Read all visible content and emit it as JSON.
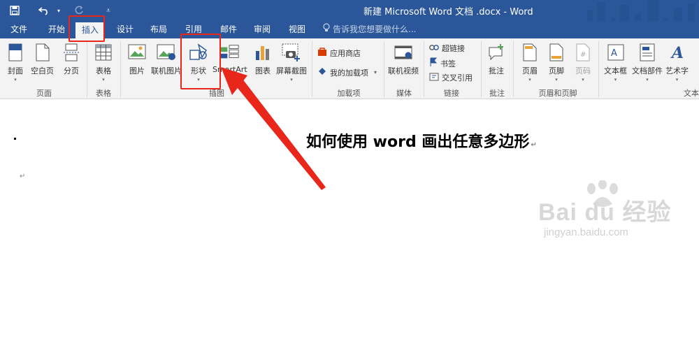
{
  "titlebar": {
    "title": "新建 Microsoft Word 文档 .docx - Word",
    "qat": {
      "save_icon": "save-icon",
      "undo_icon": "undo-icon",
      "redo_icon": "redo-icon",
      "customize_icon": "customize-icon"
    }
  },
  "tabs": [
    {
      "label": "文件",
      "active": false
    },
    {
      "label": "开始",
      "active": false
    },
    {
      "label": "插入",
      "active": true
    },
    {
      "label": "设计",
      "active": false
    },
    {
      "label": "布局",
      "active": false
    },
    {
      "label": "引用",
      "active": false
    },
    {
      "label": "邮件",
      "active": false
    },
    {
      "label": "审阅",
      "active": false
    },
    {
      "label": "视图",
      "active": false
    }
  ],
  "tell_me": {
    "placeholder": "告诉我您想要做什么..."
  },
  "ribbon": {
    "pages": {
      "cover": "封面",
      "blank": "空白页",
      "break": "分页",
      "group": "页面"
    },
    "tables": {
      "table": "表格",
      "group": "表格"
    },
    "illustrations": {
      "picture": "图片",
      "online_picture": "联机图片",
      "shapes": "形状",
      "smartart": "SmartArt",
      "chart": "图表",
      "screenshot": "屏幕截图",
      "group": "插图"
    },
    "addins": {
      "store": "应用商店",
      "my_addins": "我的加载项",
      "group": "加载项"
    },
    "media": {
      "online_video": "联机视频",
      "group": "媒体"
    },
    "links": {
      "hyperlink": "超链接",
      "bookmark": "书签",
      "cross_ref": "交叉引用",
      "group": "链接"
    },
    "comments": {
      "comment": "批注",
      "group": "批注"
    },
    "header_footer": {
      "header": "页眉",
      "footer": "页脚",
      "page_number": "页码",
      "group": "页眉和页脚"
    },
    "text": {
      "textbox": "文本框",
      "quick_parts": "文档部件",
      "wordart": "艺术字",
      "group": "文本"
    }
  },
  "document": {
    "heading": "如何使用 word 画出任意多边形",
    "para_mark": "↵"
  },
  "watermark": {
    "brand": "Bai du 经验",
    "url": "jingyan.baidu.com"
  },
  "colors": {
    "titlebar": "#2b579a",
    "highlight": "#e8261a"
  }
}
